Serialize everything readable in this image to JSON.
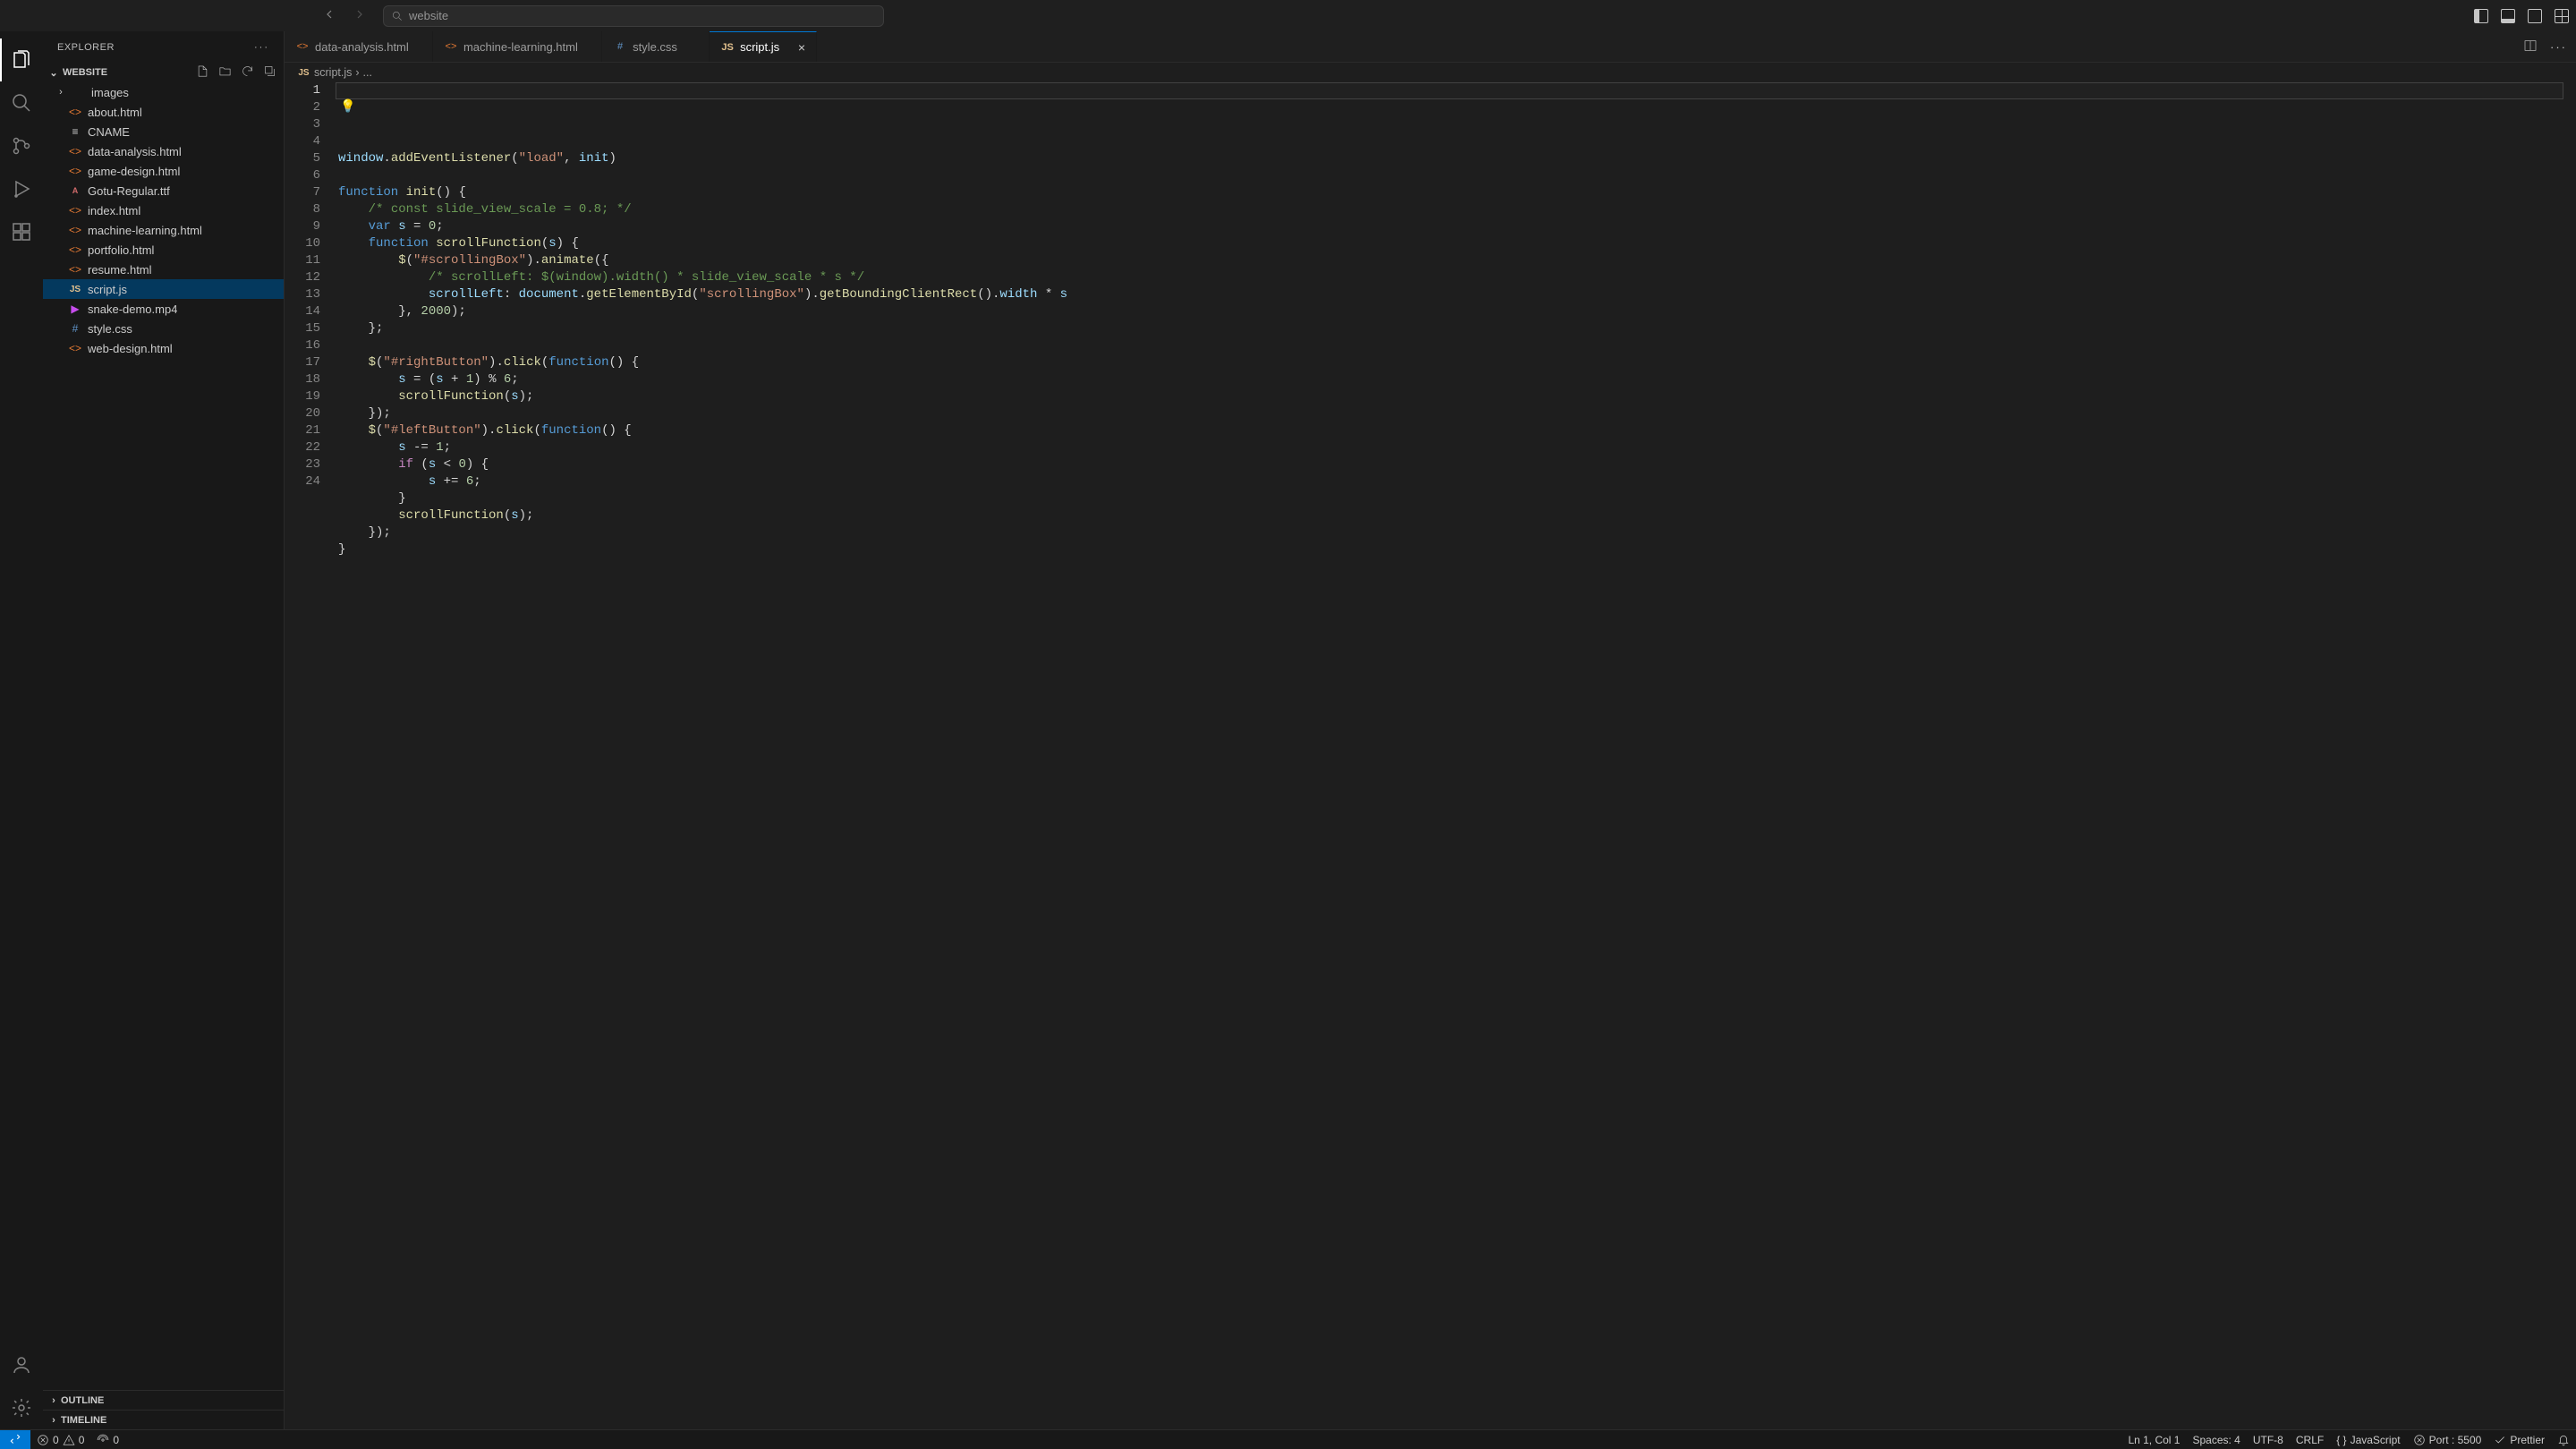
{
  "titlebar": {
    "search_placeholder": "website"
  },
  "activitybar": {
    "items": [
      "explorer",
      "search",
      "source-control",
      "run",
      "extensions"
    ],
    "bottom": [
      "accounts",
      "settings"
    ]
  },
  "sidebar": {
    "title": "EXPLORER",
    "folder": "WEBSITE",
    "tree": [
      {
        "type": "folder",
        "name": "images",
        "icon": "folder"
      },
      {
        "type": "file",
        "name": "about.html",
        "icon": "html"
      },
      {
        "type": "file",
        "name": "CNAME",
        "icon": "txt"
      },
      {
        "type": "file",
        "name": "data-analysis.html",
        "icon": "html"
      },
      {
        "type": "file",
        "name": "game-design.html",
        "icon": "html"
      },
      {
        "type": "file",
        "name": "Gotu-Regular.ttf",
        "icon": "font"
      },
      {
        "type": "file",
        "name": "index.html",
        "icon": "html"
      },
      {
        "type": "file",
        "name": "machine-learning.html",
        "icon": "html"
      },
      {
        "type": "file",
        "name": "portfolio.html",
        "icon": "html"
      },
      {
        "type": "file",
        "name": "resume.html",
        "icon": "html"
      },
      {
        "type": "file",
        "name": "script.js",
        "icon": "js",
        "selected": true
      },
      {
        "type": "file",
        "name": "snake-demo.mp4",
        "icon": "video"
      },
      {
        "type": "file",
        "name": "style.css",
        "icon": "css"
      },
      {
        "type": "file",
        "name": "web-design.html",
        "icon": "html"
      }
    ],
    "sections": [
      "OUTLINE",
      "TIMELINE"
    ]
  },
  "tabs": [
    {
      "name": "data-analysis.html",
      "icon": "html"
    },
    {
      "name": "machine-learning.html",
      "icon": "html"
    },
    {
      "name": "style.css",
      "icon": "css"
    },
    {
      "name": "script.js",
      "icon": "js",
      "active": true
    }
  ],
  "breadcrumbs": {
    "file_icon": "js",
    "file": "script.js",
    "sep": "›",
    "tail": "..."
  },
  "code": {
    "lines": [
      [
        [
          "v",
          "window"
        ],
        [
          "p",
          "."
        ],
        [
          "fn",
          "addEventListener"
        ],
        [
          "p",
          "("
        ],
        [
          "s",
          "\"load\""
        ],
        [
          "p",
          ", "
        ],
        [
          "v",
          "init"
        ],
        [
          "p",
          ")"
        ]
      ],
      [],
      [
        [
          "k",
          "function"
        ],
        [
          "p",
          " "
        ],
        [
          "fn",
          "init"
        ],
        [
          "p",
          "() {"
        ]
      ],
      [
        [
          "p",
          "    "
        ],
        [
          "c",
          "/* const slide_view_scale = 0.8; */"
        ]
      ],
      [
        [
          "p",
          "    "
        ],
        [
          "k",
          "var"
        ],
        [
          "p",
          " "
        ],
        [
          "v",
          "s"
        ],
        [
          "p",
          " = "
        ],
        [
          "n",
          "0"
        ],
        [
          "p",
          ";"
        ]
      ],
      [
        [
          "p",
          "    "
        ],
        [
          "k",
          "function"
        ],
        [
          "p",
          " "
        ],
        [
          "fn",
          "scrollFunction"
        ],
        [
          "p",
          "("
        ],
        [
          "v",
          "s"
        ],
        [
          "p",
          ") {"
        ]
      ],
      [
        [
          "p",
          "        "
        ],
        [
          "fn",
          "$"
        ],
        [
          "p",
          "("
        ],
        [
          "s",
          "\"#scrollingBox\""
        ],
        [
          "p",
          ")."
        ],
        [
          "fn",
          "animate"
        ],
        [
          "p",
          "({"
        ]
      ],
      [
        [
          "p",
          "            "
        ],
        [
          "c",
          "/* scrollLeft: $(window).width() * slide_view_scale * s */"
        ]
      ],
      [
        [
          "p",
          "            "
        ],
        [
          "v",
          "scrollLeft"
        ],
        [
          "p",
          ": "
        ],
        [
          "v",
          "document"
        ],
        [
          "p",
          "."
        ],
        [
          "fn",
          "getElementById"
        ],
        [
          "p",
          "("
        ],
        [
          "s",
          "\"scrollingBox\""
        ],
        [
          "p",
          ")."
        ],
        [
          "fn",
          "getBoundingClientRect"
        ],
        [
          "p",
          "()."
        ],
        [
          "v",
          "width"
        ],
        [
          "p",
          " * "
        ],
        [
          "v",
          "s"
        ]
      ],
      [
        [
          "p",
          "        }, "
        ],
        [
          "n",
          "2000"
        ],
        [
          "p",
          ");"
        ]
      ],
      [
        [
          "p",
          "    };"
        ]
      ],
      [],
      [
        [
          "p",
          "    "
        ],
        [
          "fn",
          "$"
        ],
        [
          "p",
          "("
        ],
        [
          "s",
          "\"#rightButton\""
        ],
        [
          "p",
          ")."
        ],
        [
          "fn",
          "click"
        ],
        [
          "p",
          "("
        ],
        [
          "k",
          "function"
        ],
        [
          "p",
          "() {"
        ]
      ],
      [
        [
          "p",
          "        "
        ],
        [
          "v",
          "s"
        ],
        [
          "p",
          " = ("
        ],
        [
          "v",
          "s"
        ],
        [
          "p",
          " + "
        ],
        [
          "n",
          "1"
        ],
        [
          "p",
          ") % "
        ],
        [
          "n",
          "6"
        ],
        [
          "p",
          ";"
        ]
      ],
      [
        [
          "p",
          "        "
        ],
        [
          "fn",
          "scrollFunction"
        ],
        [
          "p",
          "("
        ],
        [
          "v",
          "s"
        ],
        [
          "p",
          ");"
        ]
      ],
      [
        [
          "p",
          "    });"
        ]
      ],
      [
        [
          "p",
          "    "
        ],
        [
          "fn",
          "$"
        ],
        [
          "p",
          "("
        ],
        [
          "s",
          "\"#leftButton\""
        ],
        [
          "p",
          ")."
        ],
        [
          "fn",
          "click"
        ],
        [
          "p",
          "("
        ],
        [
          "k",
          "function"
        ],
        [
          "p",
          "() {"
        ]
      ],
      [
        [
          "p",
          "        "
        ],
        [
          "v",
          "s"
        ],
        [
          "p",
          " -= "
        ],
        [
          "n",
          "1"
        ],
        [
          "p",
          ";"
        ]
      ],
      [
        [
          "p",
          "        "
        ],
        [
          "kc",
          "if"
        ],
        [
          "p",
          " ("
        ],
        [
          "v",
          "s"
        ],
        [
          "p",
          " < "
        ],
        [
          "n",
          "0"
        ],
        [
          "p",
          ") {"
        ]
      ],
      [
        [
          "p",
          "            "
        ],
        [
          "v",
          "s"
        ],
        [
          "p",
          " += "
        ],
        [
          "n",
          "6"
        ],
        [
          "p",
          ";"
        ]
      ],
      [
        [
          "p",
          "        }"
        ]
      ],
      [
        [
          "p",
          "        "
        ],
        [
          "fn",
          "scrollFunction"
        ],
        [
          "p",
          "("
        ],
        [
          "v",
          "s"
        ],
        [
          "p",
          ");"
        ]
      ],
      [
        [
          "p",
          "    });"
        ]
      ],
      [
        [
          "p",
          "}"
        ]
      ]
    ],
    "bulb_line": 2
  },
  "statusbar": {
    "errors": "0",
    "warnings": "0",
    "ports": "0",
    "cursor": "Ln 1, Col 1",
    "spaces": "Spaces: 4",
    "encoding": "UTF-8",
    "eol": "CRLF",
    "language": "JavaScript",
    "port": "Port : 5500",
    "prettier": "Prettier"
  }
}
